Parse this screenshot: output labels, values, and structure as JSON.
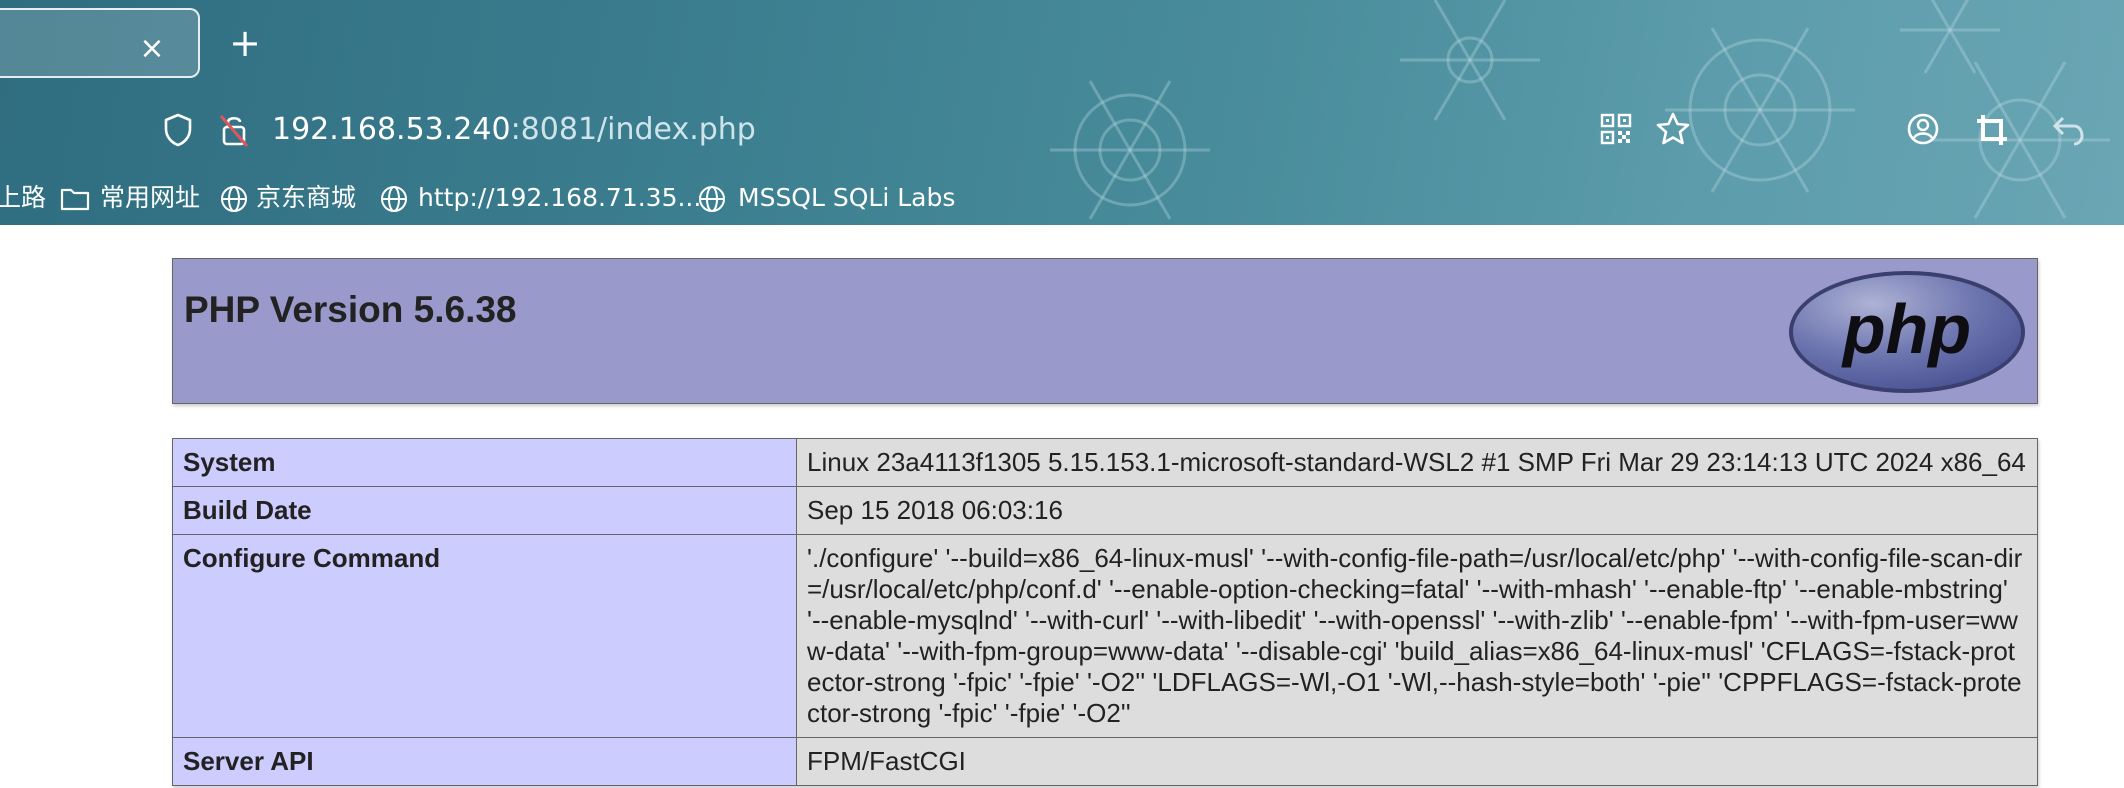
{
  "browser": {
    "tab": {
      "close_glyph": "×"
    },
    "new_tab_glyph": "+",
    "address": {
      "host": "192.168.53.240",
      "rest": ":8081/index.php"
    },
    "icons": [
      "shield-icon",
      "lock-insecure-icon",
      "qr-code-icon",
      "star-icon",
      "account-icon",
      "crop-icon",
      "undo-icon"
    ],
    "bookmarks": [
      {
        "label": "上路",
        "icon": "none"
      },
      {
        "label": "常用网址",
        "icon": "folder-icon"
      },
      {
        "label": "京东商城",
        "icon": "globe-icon"
      },
      {
        "label": "http://192.168.71.35...",
        "icon": "globe-icon"
      },
      {
        "label": "MSSQL SQLi Labs",
        "icon": "globe-icon"
      }
    ]
  },
  "page": {
    "title": "PHP Version 5.6.38",
    "logo_text": "php",
    "rows": [
      {
        "key": "System",
        "value": "Linux 23a4113f1305 5.15.153.1-microsoft-standard-WSL2 #1 SMP Fri Mar 29 23:14:13 UTC 2024 x86_64"
      },
      {
        "key": "Build Date",
        "value": "Sep 15 2018 06:03:16"
      },
      {
        "key": "Configure Command",
        "value": "'./configure' '--build=x86_64-linux-musl' '--with-config-file-path=/usr/local/etc/php' '--with-config-file-scan-dir=/usr/local/etc/php/conf.d' '--enable-option-checking=fatal' '--with-mhash' '--enable-ftp' '--enable-mbstring' '--enable-mysqlnd' '--with-curl' '--with-libedit' '--with-openssl' '--with-zlib' '--enable-fpm' '--with-fpm-user=www-data' '--with-fpm-group=www-data' '--disable-cgi' 'build_alias=x86_64-linux-musl' 'CFLAGS=-fstack-protector-strong '-fpic' '-fpie' '-O2'' 'LDFLAGS=-Wl,-O1 '-Wl,--hash-style=both' '-pie'' 'CPPFLAGS=-fstack-protector-strong '-fpic' '-fpie' '-O2''"
      },
      {
        "key": "Server API",
        "value": "FPM/FastCGI"
      }
    ]
  },
  "colors": {
    "header_bg": "#9999cc",
    "key_cell_bg": "#ccccff",
    "value_cell_bg": "#dddddd",
    "chrome_bg": "#3c7f90"
  }
}
